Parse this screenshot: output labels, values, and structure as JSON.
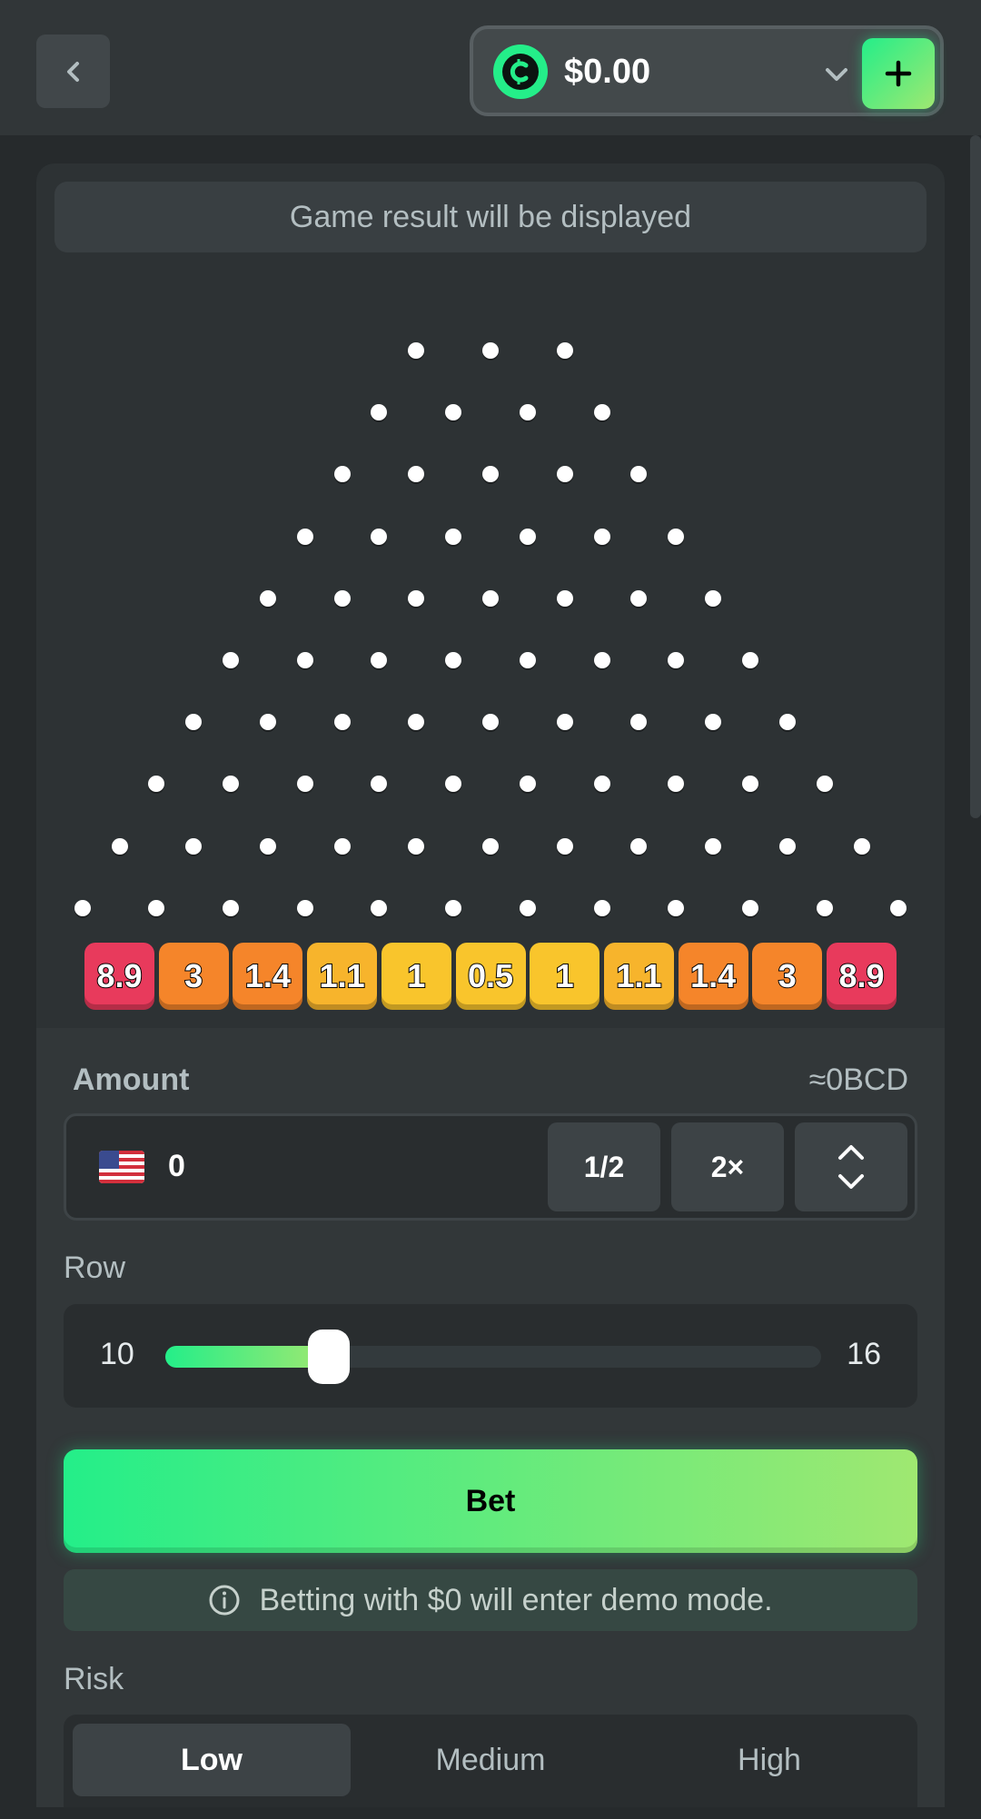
{
  "header": {
    "back_icon": "chevron-left-icon",
    "balance": "$0.00",
    "currency_icon": "coin-icon",
    "dropdown_icon": "chevron-down-icon",
    "deposit_icon": "plus-icon"
  },
  "game": {
    "result_text": "Game result will be displayed",
    "peg_rows": 10,
    "multipliers": [
      "8.9",
      "3",
      "1.4",
      "1.1",
      "1",
      "0.5",
      "1",
      "1.1",
      "1.4",
      "3",
      "8.9"
    ],
    "bucket_colors": [
      "#e83a5c",
      "#f5852a",
      "#f5852a",
      "#f7b42c",
      "#f9c52c",
      "#f9c52c",
      "#f9c52c",
      "#f7b42c",
      "#f5852a",
      "#f5852a",
      "#e83a5c"
    ]
  },
  "amount": {
    "label": "Amount",
    "approx": "≈0BCD",
    "value": "0",
    "currency_flag": "us-flag-icon",
    "half_label": "1/2",
    "double_label": "2×",
    "adjust_icon": "up-down-chevron-icon"
  },
  "row": {
    "label": "Row",
    "min": "10",
    "max": "16",
    "value": 10
  },
  "bet": {
    "label": "Bet",
    "demo_note": "Betting with $0 will enter demo mode.",
    "info_icon": "info-icon"
  },
  "risk": {
    "label": "Risk",
    "options": [
      "Low",
      "Medium",
      "High"
    ],
    "selected": "Low"
  },
  "colors": {
    "accent_green": "#24ee89",
    "accent_lime": "#9fe871",
    "background": "#262a2c"
  }
}
